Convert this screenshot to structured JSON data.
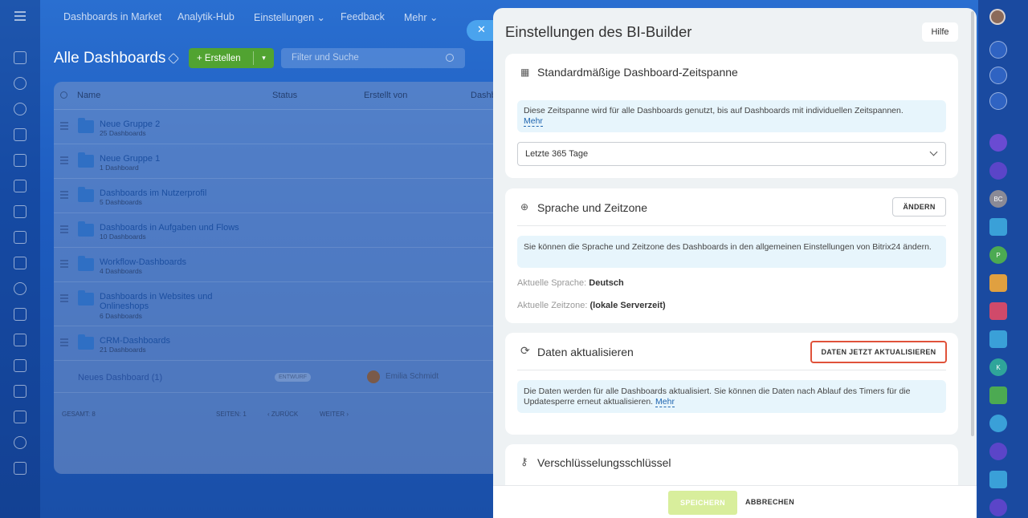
{
  "topnav": {
    "items": [
      "Dashboards in Market",
      "Analytik-Hub",
      "Einstellungen ⌄",
      "Feedback",
      "Mehr ⌄"
    ]
  },
  "page": {
    "title": "Alle Dashboards",
    "create_label": "+  Erstellen",
    "search_placeholder": "Filter und Suche"
  },
  "table": {
    "columns": [
      "Name",
      "Status",
      "Erstellt von",
      "Dashb"
    ],
    "rows": [
      {
        "name": "Neue Gruppe 2",
        "count": "25 Dashboards"
      },
      {
        "name": "Neue Gruppe 1",
        "count": "1 Dashboard"
      },
      {
        "name": "Dashboards im Nutzerprofil",
        "count": "5 Dashboards"
      },
      {
        "name": "Dashboards in Aufgaben und Flows",
        "count": "10 Dashboards"
      },
      {
        "name": "Workflow-Dashboards",
        "count": "4 Dashboards"
      },
      {
        "name": "Dashboards in Websites und Onlineshops",
        "count": "6 Dashboards"
      },
      {
        "name": "CRM-Dashboards",
        "count": "21 Dashboards"
      }
    ],
    "dashboard_row": {
      "name": "Neues Dashboard (1)",
      "status": "ENTWURF",
      "author": "Emilia Schmidt"
    },
    "footer": {
      "total": "GESAMT: 8",
      "pages": "SEITEN:  1",
      "prev": "‹ ZURÜCK",
      "next": "WEITER ›"
    }
  },
  "panel": {
    "title": "Einstellungen des BI-Builder",
    "help": "Hilfe",
    "period": {
      "heading": "Standardmäßige Dashboard-Zeitspanne",
      "info": "Diese Zeitspanne wird für alle Dashboards genutzt, bis auf Dashboards mit individuellen Zeitspannen.",
      "more": "Mehr",
      "selected": "Letzte 365 Tage"
    },
    "lang": {
      "heading": "Sprache und Zeitzone",
      "change": "ÄNDERN",
      "info": "Sie können die Sprache und Zeitzone des Dashboards in den allgemeinen Einstellungen von Bitrix24 ändern.",
      "lang_label": "Aktuelle Sprache:",
      "lang_value": "Deutsch",
      "tz_label": "Aktuelle Zeitzone:",
      "tz_value": "(lokale Serverzeit)"
    },
    "refresh": {
      "heading": "Daten aktualisieren",
      "button": "DATEN JETZT AKTUALISIEREN",
      "info": "Die Daten werden für alle Dashboards aktualisiert. Sie können die Daten nach Ablauf des Timers für die Updatesperre erneut aktualisieren.",
      "more": "Mehr"
    },
    "key": {
      "heading": "Verschlüsselungsschlüssel"
    },
    "save": "SPEICHERN",
    "cancel": "ABBRECHEN"
  },
  "rail_right": {
    "bc": "BC",
    "p": "P",
    "k": "K"
  },
  "colors": {
    "accent": "#2066b0",
    "highlight": "#e0523a",
    "create_green": "#51a331"
  }
}
